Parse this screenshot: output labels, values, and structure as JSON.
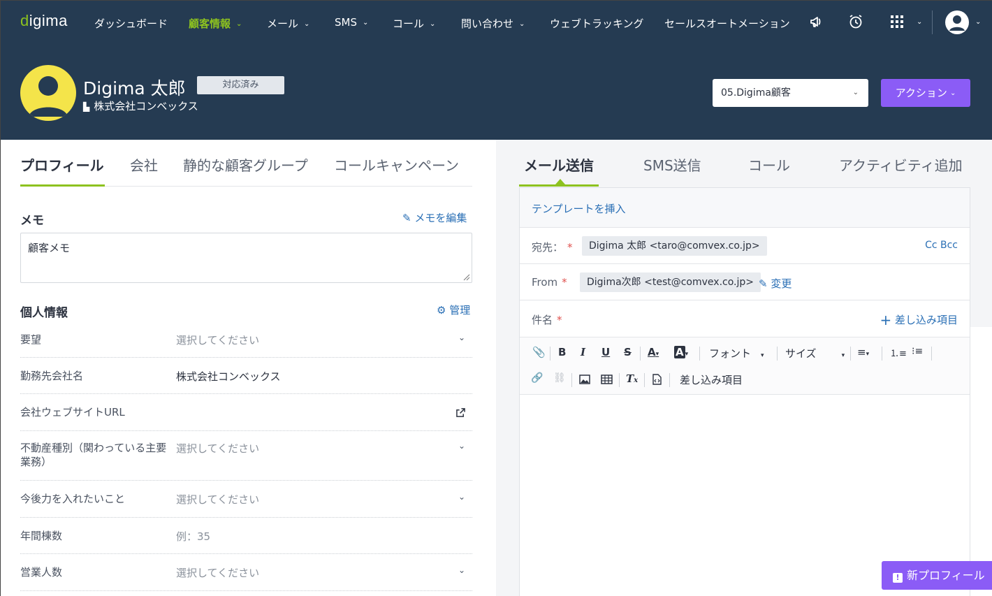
{
  "nav": {
    "logo_prefix": "d",
    "logo_rest": "igima",
    "items": [
      "ダッシュボード",
      "顧客情報",
      "メール",
      "SMS",
      "コール",
      "問い合わせ",
      "ウェブトラッキング",
      "セールスオートメーション"
    ]
  },
  "header": {
    "name": "Digima 太郎",
    "status": "対応済み",
    "company": "株式会社コンベックス",
    "group_select": "05.Digima顧客",
    "action_label": "アクション"
  },
  "left_tabs": [
    "プロフィール",
    "会社",
    "静的な顧客グループ",
    "コールキャンペーン"
  ],
  "memo": {
    "title": "メモ",
    "edit_label": "メモを編集",
    "content": "顧客メモ"
  },
  "personal": {
    "title": "個人情報",
    "manage_label": "管理",
    "rows": [
      {
        "label": "要望",
        "value": "選択してください"
      },
      {
        "label": "勤務先会社名",
        "value": "株式会社コンベックス"
      },
      {
        "label": "会社ウェブサイトURL",
        "value": ""
      },
      {
        "label": "不動産種別（関わっている主要業務）",
        "value": "選択してください"
      },
      {
        "label": "今後力を入れたいこと",
        "value": "選択してください"
      },
      {
        "label": "年間棟数",
        "value": "例：35"
      },
      {
        "label": "営業人数",
        "value": "選択してください"
      }
    ]
  },
  "right_tabs": [
    "メール送信",
    "SMS送信",
    "コール",
    "アクティビティ追加"
  ],
  "compose": {
    "template_link": "テンプレートを挿入",
    "to_label": "宛先：",
    "to_value": "Digima 太郎 <taro@comvex.co.jp>",
    "cc_bcc": "Cc Bcc",
    "from_label": "From",
    "from_value": "Digima次郎 <test@comvex.co.jp>",
    "change_label": "変更",
    "subject_label": "件名",
    "merge_label": "差し込み項目",
    "toolbar_font": "フォント",
    "toolbar_size": "サイズ",
    "toolbar_merge": "差し込み項目"
  },
  "new_profile_label": "新プロフィール",
  "colors": {
    "nav_bg": "#253b52",
    "accent_green": "#8dc21f",
    "action_purple": "#8b5cf6",
    "link_blue": "#2a6fb5"
  }
}
